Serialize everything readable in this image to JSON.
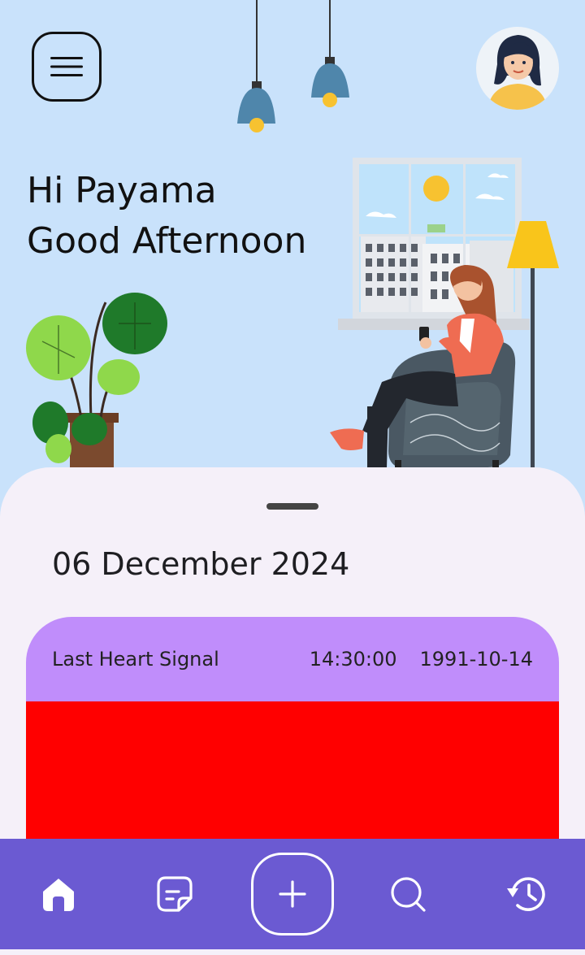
{
  "greeting": {
    "line1": "Hi Payama",
    "line2": "Good Afternoon"
  },
  "date": "06 December 2024",
  "card": {
    "label": "Last Heart Signal",
    "time": "14:30:00",
    "date": "1991-10-14"
  },
  "nav": {
    "items": [
      {
        "icon": "home-icon"
      },
      {
        "icon": "note-icon"
      },
      {
        "icon": "plus-icon"
      },
      {
        "icon": "search-icon"
      },
      {
        "icon": "history-icon"
      }
    ]
  },
  "colors": {
    "sky": "#c9e2fb",
    "sheet": "#f5f0f9",
    "card_header": "#c08dfb",
    "card_body": "#ff0000",
    "navbar": "#6b5ad2"
  }
}
